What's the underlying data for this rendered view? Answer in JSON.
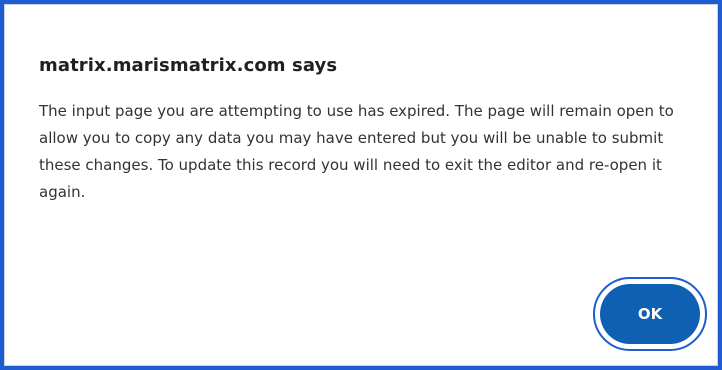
{
  "dialog": {
    "title": "matrix.marismatrix.com says",
    "message": "The input page you are attempting to use has expired. The page will remain open to allow you to copy any data you may have entered but you will be unable to submit these changes. To update this record you will need to exit the editor and re-open it again.",
    "ok_label": "OK"
  },
  "colors": {
    "frame_border": "#1f5cd1",
    "button_fill": "#0f5fb3",
    "button_text": "#ffffff"
  }
}
